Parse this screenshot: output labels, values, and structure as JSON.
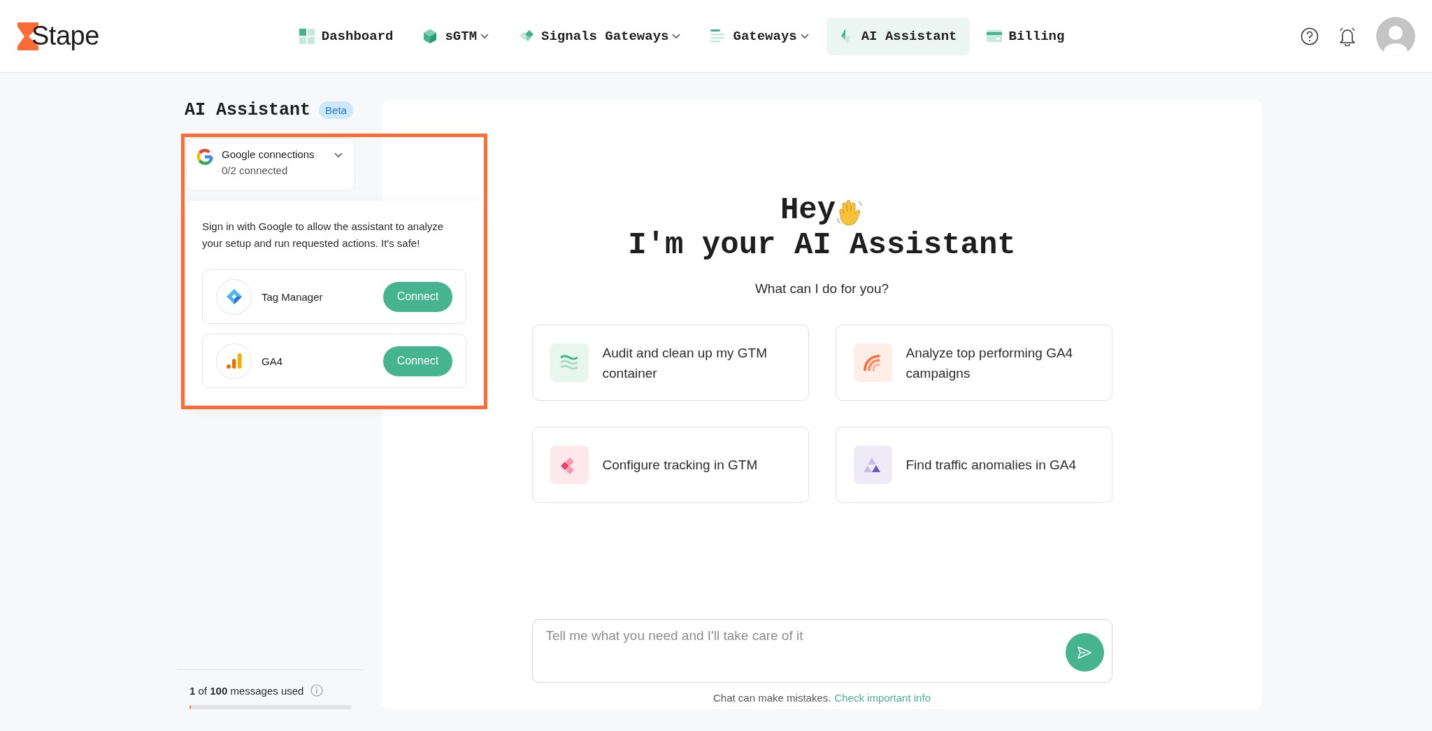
{
  "header": {
    "logo": "Stape",
    "nav": [
      {
        "label": "Dashboard",
        "dropdown": false,
        "selected": false
      },
      {
        "label": "sGTM",
        "dropdown": true,
        "selected": false
      },
      {
        "label": "Signals Gateways",
        "dropdown": true,
        "selected": false
      },
      {
        "label": "Gateways",
        "dropdown": true,
        "selected": false
      },
      {
        "label": "AI Assistant",
        "dropdown": false,
        "selected": true
      },
      {
        "label": "Billing",
        "dropdown": false,
        "selected": false
      }
    ]
  },
  "sidebar": {
    "title": "AI Assistant",
    "badge": "Beta",
    "google_connections": {
      "title": "Google connections",
      "status": "0/2 connected",
      "expanded": true,
      "note": "Sign in with Google to allow the assistant to analyze your setup and run requested actions. It's safe!",
      "services": [
        {
          "name": "Tag Manager",
          "button": "Connect"
        },
        {
          "name": "GA4",
          "button": "Connect"
        }
      ]
    },
    "usage": {
      "text": "**1** of **100** messages used",
      "level": 0.01
    }
  },
  "annotations": [
    {
      "kind": "frame"
    }
  ],
  "main": {
    "greeting": "Hey",
    "title": "I'm your AI Assistant",
    "question": "What can I do for you?",
    "suggestions": [
      {
        "text": "Audit and clean up my GTM container"
      },
      {
        "text": "Analyze top performing GA4 campaigns"
      },
      {
        "text": "Configure tracking in GTM"
      },
      {
        "text": "Find traffic anomalies in GA4"
      }
    ],
    "chat": {
      "placeholder": "Tell me what you need and I'll take care of it",
      "disclaimer": "Chat can make mistakes.",
      "link": "Check important info"
    }
  }
}
